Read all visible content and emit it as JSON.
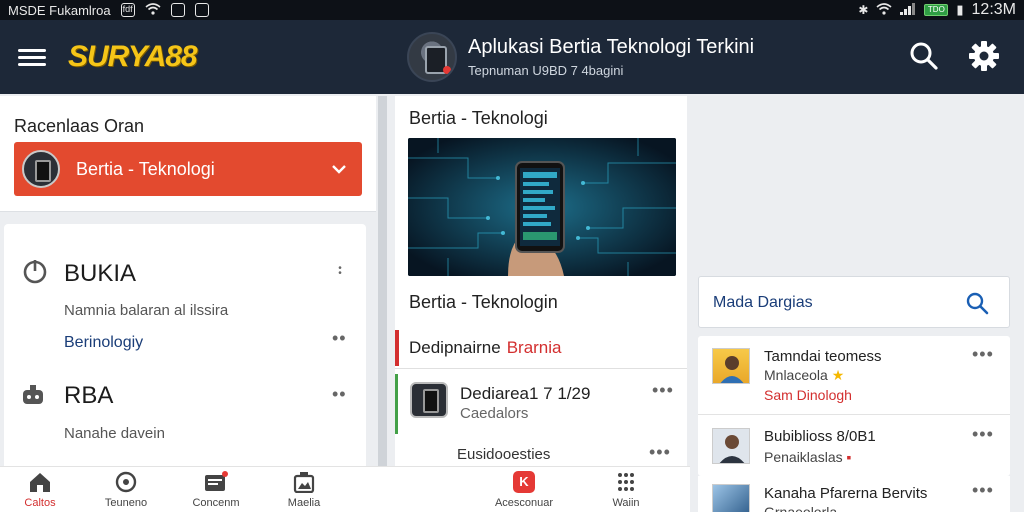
{
  "status_bar": {
    "left_text": "MSDE Fukamlroa",
    "left_badge": "fdf",
    "right_battery": "TDO",
    "time": "12:3M"
  },
  "app_bar": {
    "logo": "SURYA88",
    "title": "Aplukasi Bertia  Teknologi Terkini",
    "subtitle": "Tepnuman U9BD 7 4bagini",
    "icons": [
      "menu-icon",
      "search-icon",
      "gear-icon"
    ]
  },
  "left_panel": {
    "section_label": "Racenlaas Oran",
    "selected_category": "Bertia - Teknologi",
    "items": [
      {
        "title": "BUKIA",
        "subtitle": "Namnia balaran al ilssira",
        "link": "Berinologiy"
      },
      {
        "title": "RBA",
        "subtitle": "Nanahe davein"
      }
    ]
  },
  "middle_panel": {
    "header": "Bertia - Teknologi",
    "caption": "Bertia - Teknologin",
    "highlight_text": "Dedipnairne",
    "highlight_red": "Brarnia",
    "item": {
      "title": "Dediarea1 7 1/29",
      "subtitle": "Caedalors"
    },
    "item2": "Eusidooesties"
  },
  "right_panel": {
    "search_placeholder": "Mada Dargias",
    "items": [
      {
        "title": "Tamndai teomess",
        "line2": "Mnlaceola",
        "line3": "Sam Dinologh"
      },
      {
        "title": "Bubiblioss 8/0B1",
        "line2": "Penaiklaslas"
      },
      {
        "title": "Kanaha Pfarerna Bervits",
        "line2": "Grnaeolorla"
      }
    ]
  },
  "bottom_nav": [
    {
      "label": "Caltos",
      "icon": "home-icon",
      "active": true
    },
    {
      "label": "Teuneno",
      "icon": "compass-icon",
      "active": false
    },
    {
      "label": "Concenm",
      "icon": "news-icon",
      "active": false
    },
    {
      "label": "Maelia",
      "icon": "media-icon",
      "active": false
    },
    {
      "label": "Acesconuar",
      "icon": "app-k-icon",
      "active": false,
      "badge": "K"
    },
    {
      "label": "Waiin",
      "icon": "grid-icon",
      "active": false
    }
  ],
  "colors": {
    "app_bar": "#1d2838",
    "accent_red": "#e34a2f",
    "logo_yellow": "#f5c518",
    "link_blue": "#1a3d78"
  }
}
